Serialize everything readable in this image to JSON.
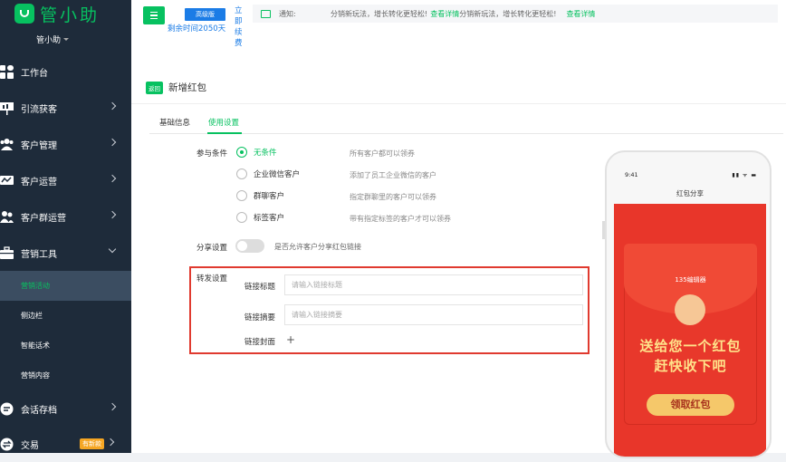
{
  "app": {
    "logo_text": "管小助",
    "user": "管小助"
  },
  "sidebar": {
    "items": [
      {
        "label": "工作台",
        "icon": "dashboard-icon"
      },
      {
        "label": "引流获客",
        "icon": "presentation-icon"
      },
      {
        "label": "客户管理",
        "icon": "users-icon"
      },
      {
        "label": "客户运营",
        "icon": "chat-icon"
      },
      {
        "label": "客户群运营",
        "icon": "group-icon"
      },
      {
        "label": "营销工具",
        "icon": "briefcase-icon"
      }
    ],
    "sub_items": [
      "营销活动",
      "侧边栏",
      "智能话术",
      "营销内容"
    ],
    "bottom_items": [
      {
        "label": "会话存档",
        "icon": "chat-archive-icon"
      },
      {
        "label": "交易",
        "icon": "trade-icon",
        "badge": "有新款"
      }
    ]
  },
  "topbar": {
    "plan": "高级版",
    "remaining": "剩余时间2050天",
    "renew": "立即续费",
    "notice_label": "通知:",
    "notice_msg1": "分销新玩法，增长转化更轻松!",
    "notice_link1": "查看详情",
    "notice_msg2": "分销新玩法，增长转化更轻松!",
    "notice_link2": "查看详情"
  },
  "page": {
    "back_label": "返回",
    "title": "新增红包",
    "tabs": [
      "基础信息",
      "使用设置"
    ],
    "conditions_label": "参与条件",
    "conditions": [
      {
        "label": "无条件",
        "desc": "所有客户都可以领券",
        "selected": true
      },
      {
        "label": "企业微信客户",
        "desc": "添加了员工企业微信的客户",
        "selected": false
      },
      {
        "label": "群聊客户",
        "desc": "指定群聊里的客户可以领券",
        "selected": false
      },
      {
        "label": "标签客户",
        "desc": "带有指定标签的客户才可以领券",
        "selected": false
      }
    ],
    "share_label": "分享设置",
    "share_desc": "是否允许客户分享红包链接",
    "forward_label": "转发设置",
    "link_title_label": "链接标题",
    "link_title_placeholder": "请输入链接标题",
    "link_summary_label": "链接摘要",
    "link_summary_placeholder": "请输入链接摘要",
    "link_cover_label": "链接封面",
    "add_symbol": "+"
  },
  "preview": {
    "time": "9:41",
    "signal": "▮▮ ᯤ ▬",
    "title": "红包分享",
    "brand": "135编辑器",
    "line1": "送给您一个红包",
    "line2": "赶快收下吧",
    "button": "领取红包"
  },
  "colors": {
    "accent": "#07c160",
    "sidebar_bg": "#1e2b3a",
    "highlight_border": "#e03a2f",
    "plan_blue": "#1b7ce6",
    "envelope_red": "#e8362a"
  }
}
